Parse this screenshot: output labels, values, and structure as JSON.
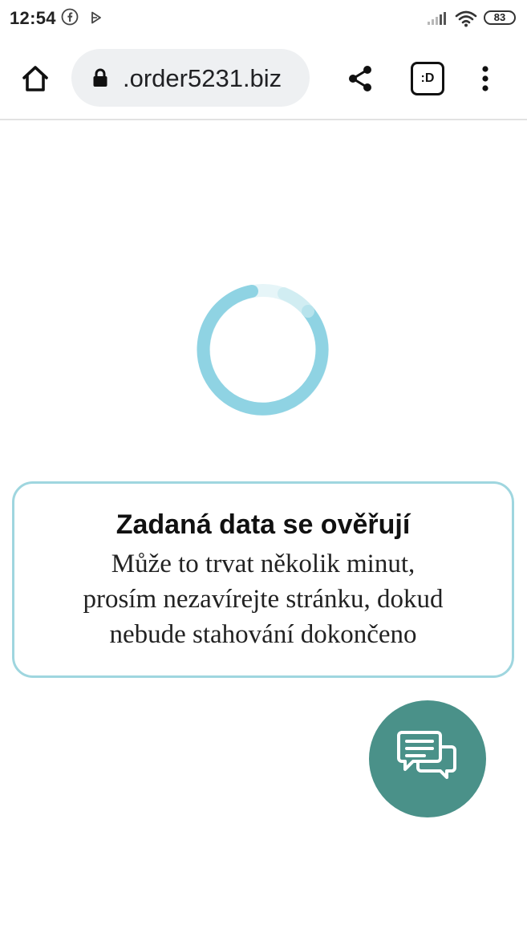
{
  "status_bar": {
    "time": "12:54",
    "battery": "83",
    "icons": [
      "facebook-icon",
      "play-icon",
      "signal-icon",
      "wifi-icon",
      "battery-icon"
    ]
  },
  "toolbar": {
    "url": ".order5231.biz",
    "icons": [
      "home-icon",
      "lock-icon",
      "share-icon",
      "tab-switcher-icon",
      "more-vert-icon"
    ],
    "tab_badge": ":D"
  },
  "spinner": {
    "icon": "loading-spinner-icon",
    "color": "#8fd3e3"
  },
  "card": {
    "title": "Zadaná data se ověřují",
    "lines": [
      "Může to trvat několik minut,",
      "prosím nezavírejte stránku, dokud",
      "nebude stahování dokončeno"
    ],
    "border_color": "#9fd6df"
  },
  "chat": {
    "icon": "chat-bubbles-icon",
    "color": "#4a9189"
  }
}
